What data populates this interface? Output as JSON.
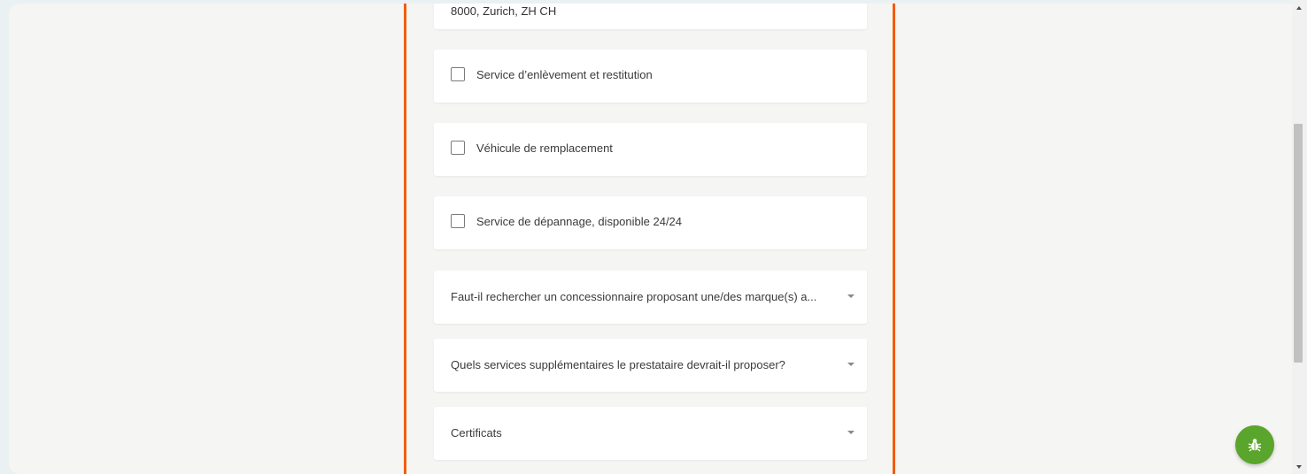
{
  "form": {
    "address_value": "8000, Zurich, ZH CH",
    "checkboxes": [
      {
        "label": "Service d’enlèvement et restitution",
        "checked": false
      },
      {
        "label": "Véhicule de remplacement",
        "checked": false
      },
      {
        "label": "Service de dépannage, disponible 24/24",
        "checked": false
      }
    ],
    "selects": [
      {
        "label": "Faut-il rechercher un concessionnaire proposant une/des marque(s) a..."
      },
      {
        "label": "Quels services supplémentaires le prestataire devrait-il proposer?"
      },
      {
        "label": "Certificats"
      }
    ]
  },
  "colors": {
    "accent_border": "#f25c05",
    "bug_button": "#5aa52b",
    "background": "#f5f5f3"
  },
  "icons": {
    "checkbox": "checkbox-icon",
    "dropdown": "caret-down-icon",
    "bug_report": "bug-icon",
    "scroll_up": "arrow-up-icon",
    "scroll_down": "arrow-down-icon"
  }
}
